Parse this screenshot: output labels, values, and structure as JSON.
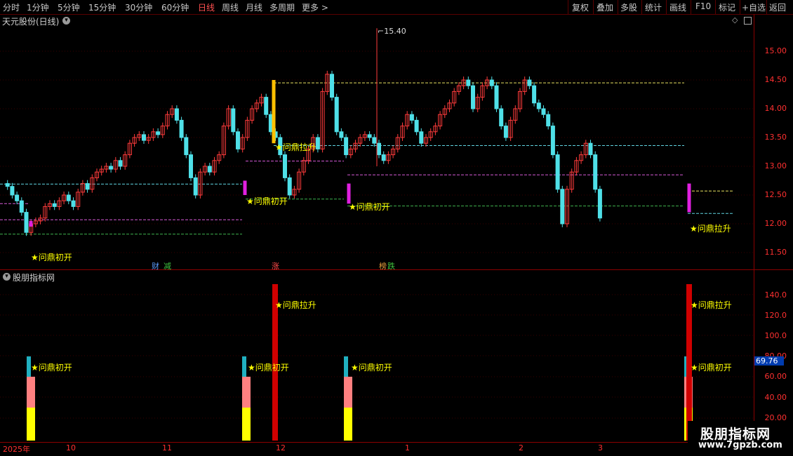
{
  "toolbar": {
    "periods": [
      "分时",
      "1分钟",
      "5分钟",
      "15分钟",
      "30分钟",
      "60分钟",
      "日线",
      "周线",
      "月线",
      "多周期",
      "更多 >"
    ],
    "active_period": "日线",
    "right_buttons": [
      "复权",
      "叠加",
      "多股",
      "统计",
      "画线",
      "F10",
      "标记",
      "+自选",
      "返回"
    ]
  },
  "main_chart": {
    "title": "天元股份(日线)",
    "high_marker": "15.40",
    "y_ticks": [
      "15.00",
      "14.50",
      "14.00",
      "13.50",
      "13.00",
      "12.50",
      "12.00",
      "11.50"
    ],
    "event_chips": [
      {
        "text": "财",
        "color": "#3a7bd5"
      },
      {
        "text": "减",
        "color": "#2e9d2e"
      },
      {
        "text": "涨",
        "color": "#c0392b"
      },
      {
        "text": "榜",
        "color": "#c8842a"
      },
      {
        "text": "跌",
        "color": "#2e9d2e"
      }
    ],
    "signals": [
      {
        "text": "★问鼎初开",
        "id": "s1"
      },
      {
        "text": "★问鼎初开",
        "id": "s2"
      },
      {
        "text": "★问鼎拉升",
        "id": "s3"
      },
      {
        "text": "★问鼎初开",
        "id": "s4"
      },
      {
        "text": "★问鼎拉升",
        "id": "s5"
      }
    ]
  },
  "indicator_panel": {
    "title": "股朋指标网",
    "y_ticks": [
      "140.0",
      "120.0",
      "100.0",
      "80.00",
      "60.00",
      "40.00",
      "20.00"
    ],
    "current_value": "69.76",
    "signals": [
      {
        "text": "★问鼎初开"
      },
      {
        "text": "★问鼎初开"
      },
      {
        "text": "★问鼎拉升"
      },
      {
        "text": "★问鼎初开"
      },
      {
        "text": "★问鼎初开"
      },
      {
        "text": "★问鼎拉升"
      }
    ]
  },
  "date_axis": [
    "2025年",
    "10",
    "11",
    "12",
    "1",
    "2",
    "3"
  ],
  "watermark": {
    "title": "股朋指标网",
    "url": "www.7gpzb.com"
  },
  "colors": {
    "up": "#ff3b3b",
    "down": "#4fe0e8",
    "signal": "#ffff00",
    "axis": "#ff3030",
    "panel_border": "#8b0000"
  }
}
